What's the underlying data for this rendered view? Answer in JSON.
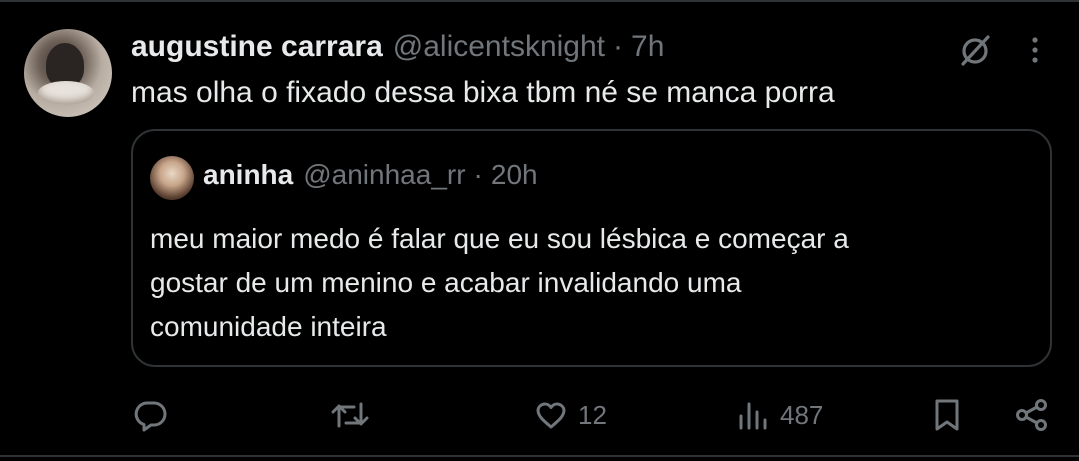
{
  "tweet": {
    "author_name": "augustine carrara",
    "author_handle": "@alicentsknight",
    "separator": "·",
    "time": "7h",
    "text": "mas olha o fixado dessa bixa tbm né se manca porra"
  },
  "quoted_tweet": {
    "author_name": "aninha",
    "author_handle": "@aninhaa_rr",
    "separator": "·",
    "time": "20h",
    "text_lines": [
      "meu maior medo é falar que eu sou lésbica e começar a",
      "gostar de um menino e acabar invalidando uma",
      "comunidade inteira"
    ]
  },
  "actions": {
    "reply_count": "",
    "retweet_count": "",
    "like_count": "12",
    "view_count": "487"
  },
  "icons": {
    "grok": "grok-icon",
    "more": "more-icon",
    "reply": "reply-icon",
    "retweet": "retweet-icon",
    "like": "heart-icon",
    "views": "views-icon",
    "bookmark": "bookmark-icon",
    "share": "share-icon"
  },
  "colors": {
    "background": "#000000",
    "text_primary": "#e7e9ea",
    "text_secondary": "#71767b",
    "border": "#2f3336"
  }
}
